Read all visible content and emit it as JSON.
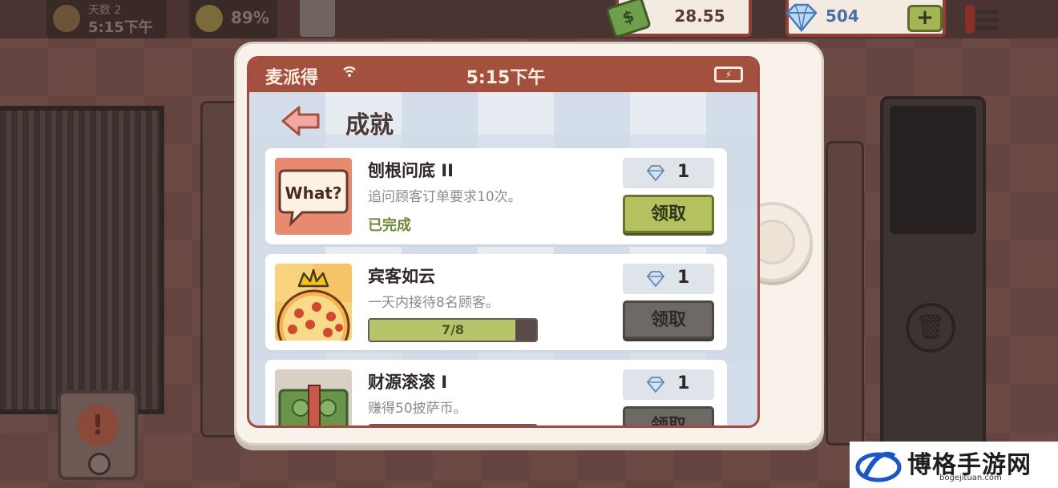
{
  "hud": {
    "day_label": "天数 2",
    "day_time": "5:15下午",
    "mood": "89%",
    "money": "28.55",
    "gems": "504",
    "add_gems_symbol": "+"
  },
  "tablet": {
    "status": {
      "app_name": "麦派得",
      "time": "5:15下午"
    },
    "page_title": "成就",
    "achievements": [
      {
        "title": "刨根问底 II",
        "description": "追问顾客订单要求10次。",
        "status_text": "已完成",
        "image_text": "What?",
        "reward": "1",
        "claim_label": "领取",
        "claimable": true
      },
      {
        "title": "宾客如云",
        "description": "一天内接待8名顾客。",
        "progress_text": "7/8",
        "progress_fraction": 0.875,
        "reward": "1",
        "claim_label": "领取",
        "claimable": false
      },
      {
        "title": "财源滚滚 I",
        "description": "赚得50披萨币。",
        "progress_fraction": 0.42,
        "reward": "1",
        "claim_label": "领取",
        "claimable": false
      }
    ]
  },
  "watermark": {
    "name": "博格手游网",
    "url": "bogejituan.com"
  },
  "colors": {
    "status_bar": "#a4503f",
    "claim_active": "#b4c15e",
    "claim_disabled": "#6d6a66",
    "completed_text": "#6d8a37"
  }
}
